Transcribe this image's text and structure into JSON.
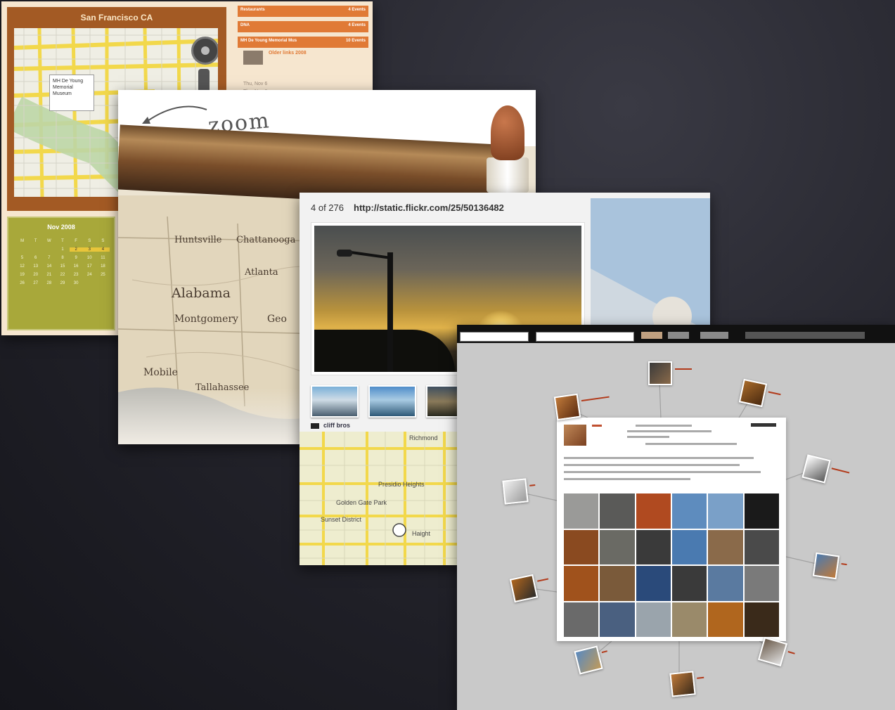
{
  "card1": {
    "map_title": "San Francisco CA",
    "map_callout": [
      "MH De Young",
      "Memorial",
      "Museum"
    ],
    "events": [
      {
        "name": "Restaurants",
        "count": "4 Events"
      },
      {
        "name": "DNA",
        "count": "4 Events"
      },
      {
        "name": "MH De Young Memorial Mus",
        "count": "10 Events"
      }
    ],
    "event_detail": {
      "title": "Older links 2008",
      "lines": [
        "Thu, Nov 6",
        "Thu, Nov 6"
      ]
    },
    "calendar": {
      "month": "Nov 2008",
      "weekdays": [
        "M",
        "T",
        "W",
        "T",
        "F",
        "S",
        "S"
      ],
      "weeks": [
        [
          "",
          "",
          "",
          "1",
          "2",
          "3",
          "4"
        ],
        [
          "5",
          "6",
          "7",
          "8",
          "9",
          "10",
          "11"
        ],
        [
          "12",
          "13",
          "14",
          "15",
          "16",
          "17",
          "18"
        ],
        [
          "19",
          "20",
          "21",
          "22",
          "23",
          "24",
          "25"
        ],
        [
          "26",
          "27",
          "28",
          "29",
          "30",
          "",
          ""
        ]
      ],
      "highlighted": [
        "2",
        "3",
        "4"
      ]
    }
  },
  "card2": {
    "zoom_word": "zoom",
    "places": [
      "Huntsville",
      "Chattanooga",
      "Atlanta",
      "Alabama",
      "Montgomery",
      "Geo",
      "Mobile",
      "Tallahassee"
    ]
  },
  "card3": {
    "counter": "4 of 276",
    "url": "http://static.flickr.com/25/50136482",
    "user": "cliff bros",
    "map_labels": [
      "Presidio Heights",
      "Golden Gate Park",
      "Sunset District",
      "Richmond",
      "Haight"
    ]
  },
  "colors": {
    "map_panel": "#a35a24",
    "event_orange": "#e07a36",
    "calendar_olive": "#a8a83a",
    "friend_name": "#b23a1a"
  },
  "icons": {
    "zoom_arrow": "curved-arrow-icon",
    "nav": "compass-nav-icon",
    "flag": "flag-icon"
  }
}
